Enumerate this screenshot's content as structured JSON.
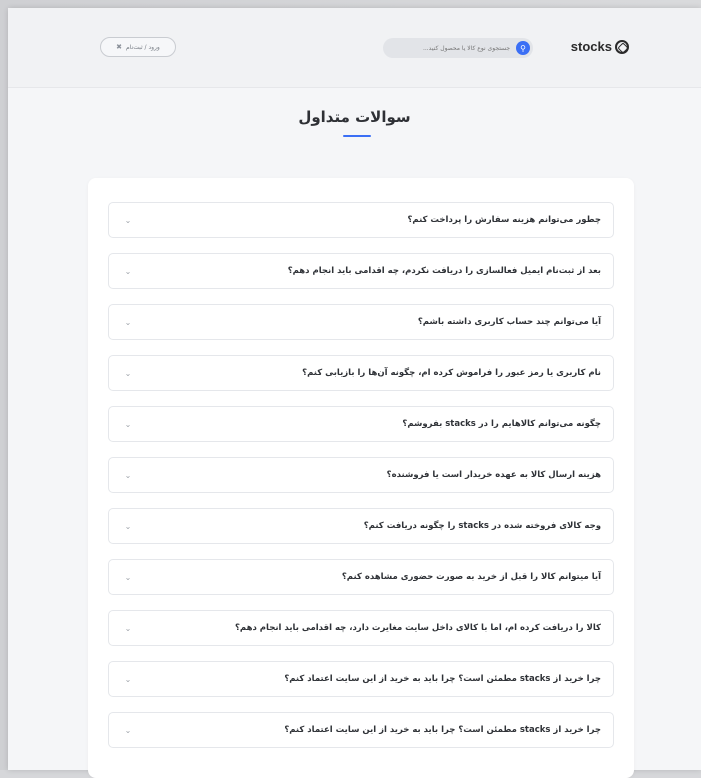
{
  "header": {
    "logo_text": "stocks",
    "search_placeholder": "جستجوی نوع کالا یا محصول کنید...",
    "login_label": "ورود / ثبت‌نام",
    "search_icon": "search-icon",
    "user_icon": "user-icon"
  },
  "page": {
    "title": "سوالات متداول"
  },
  "faq": {
    "items": [
      "چطور می‌توانم هزینه سفارش را پرداخت کنم؟",
      "بعد از ثبت‌نام ایمیل فعالسازی را دریافت نکردم، چه اقدامی باید انجام دهم؟",
      "آیا می‌توانم چند حساب کاربری داشته باشم؟",
      "نام کاربری یا رمز عبور را فراموش کرده ام، چگونه آن‌ها را بازیابی کنم؟",
      "چگونه می‌توانم کالاهایم را در stacks بفروشم؟",
      "هزینه ارسال کالا به عهده خریدار است یا فروشنده؟",
      "وجه کالای فروخته شده در stacks را چگونه دریافت کنم؟",
      "آیا میتوانم کالا را قبل از خرید به صورت حضوری مشاهده کنم؟",
      "کالا را دریافت کرده ام، اما با کالای داخل سایت مغایرت دارد، چه اقدامی باید انجام دهم؟",
      "چرا خرید از stacks مطمئن است؟ چرا باید به خرید از این سایت اعتماد کنم؟",
      "چرا خرید از stacks مطمئن است؟ چرا باید به خرید از این سایت اعتماد کنم؟"
    ],
    "chevron_icon": "chevron-down-icon"
  },
  "colors": {
    "accent": "#3b6ff5",
    "background": "#f5f6f8",
    "card": "#ffffff",
    "text": "#2f3237"
  }
}
